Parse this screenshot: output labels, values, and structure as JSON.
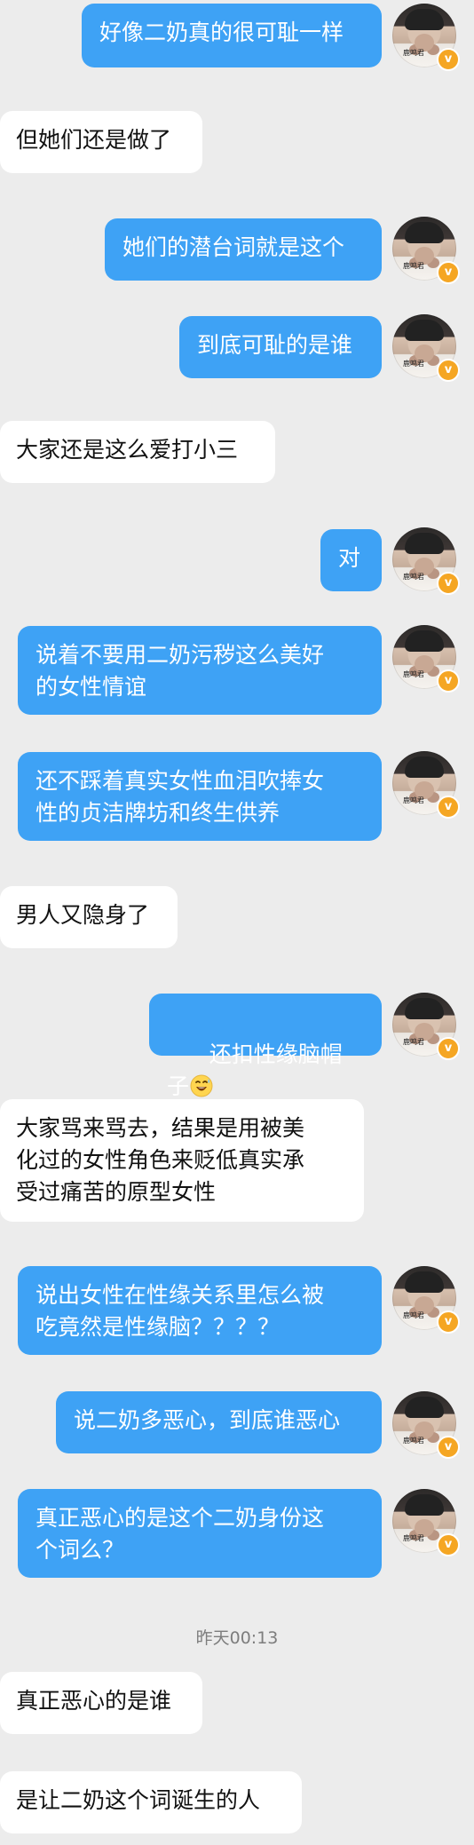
{
  "theme": {
    "background": "#ececec",
    "sent_bubble": "#3ea2f5",
    "received_bubble": "#ffffff",
    "badge_color": "#f5a623"
  },
  "avatar": {
    "name_text": "鹿鸣君",
    "badge_icon": "v-verified-badge"
  },
  "messages": [
    {
      "side": "sent",
      "text": "好像二奶真的很可耻一样"
    },
    {
      "side": "received",
      "text": "但她们还是做了"
    },
    {
      "side": "sent",
      "text": "她们的潜台词就是这个"
    },
    {
      "side": "sent",
      "text": "到底可耻的是谁"
    },
    {
      "side": "received",
      "text": "大家还是这么爱打小三"
    },
    {
      "side": "sent",
      "text": "对"
    },
    {
      "side": "sent",
      "text": "说着不要用二奶污秽这么美好\n的女性情谊"
    },
    {
      "side": "sent",
      "text": "还不踩着真实女性血泪吹捧女\n性的贞洁牌坊和终生供养"
    },
    {
      "side": "received",
      "text": "男人又隐身了"
    },
    {
      "side": "sent",
      "text": "还扣性缘脑帽子",
      "emoji": "grinning-sweat-emoji"
    },
    {
      "side": "received",
      "text": "大家骂来骂去，结果是用被美\n化过的女性角色来贬低真实承\n受过痛苦的原型女性"
    },
    {
      "side": "sent",
      "text": "说出女性在性缘关系里怎么被\n吃竟然是性缘脑？？？？"
    },
    {
      "side": "sent",
      "text": "说二奶多恶心，到底谁恶心"
    },
    {
      "side": "sent",
      "text": "真正恶心的是这个二奶身份这\n个词么？"
    },
    {
      "side": "timestamp",
      "text": "昨天00:13"
    },
    {
      "side": "received",
      "text": "真正恶心的是谁"
    },
    {
      "side": "received",
      "text": "是让二奶这个词诞生的人"
    }
  ]
}
